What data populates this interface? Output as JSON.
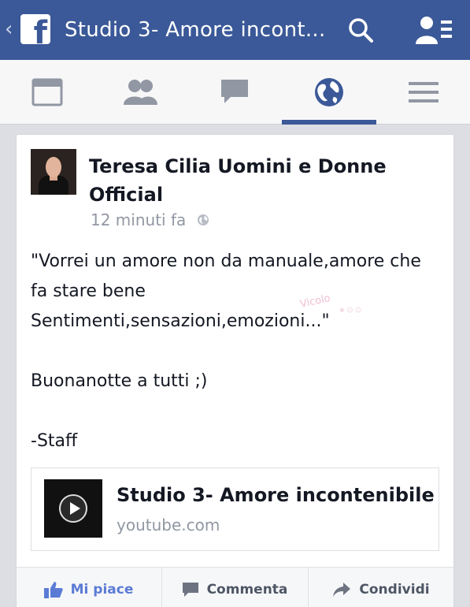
{
  "header": {
    "title": "Studio 3- Amore incont..."
  },
  "nav": {
    "tabs": [
      {
        "name": "news-feed",
        "icon": "feed-icon"
      },
      {
        "name": "friend-requests",
        "icon": "friends-icon"
      },
      {
        "name": "messages",
        "icon": "chat-icon"
      },
      {
        "name": "notifications",
        "icon": "globe-icon",
        "active": true
      },
      {
        "name": "more",
        "icon": "menu-icon"
      }
    ],
    "active_color": "#3b5998"
  },
  "post": {
    "author": "Teresa Cilia Uomini e Donne Official",
    "time": "12 minuti fa",
    "text": "\"Vorrei un amore non da manuale,amore che fa stare bene\nSentimenti,sensazioni,emozioni...\"\n\nBuonanotte a tutti ;)\n\n-Staff",
    "link": {
      "title": "Studio 3- Amore incontenibile",
      "domain": "youtube.com"
    },
    "actions": {
      "like": "Mi piace",
      "comment": "Commenta",
      "share": "Condividi"
    }
  },
  "colors": {
    "brand": "#3b5998",
    "like": "#5b7bd5"
  }
}
